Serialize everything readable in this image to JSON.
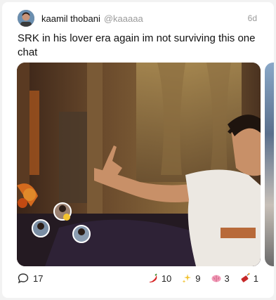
{
  "post": {
    "author_name": "kaamil thobani",
    "author_handle": "@kaaaaa",
    "time": "6d",
    "text": "SRK in his lover era again im not surviving this one chat"
  },
  "reactions": {
    "replies": "17",
    "pepper": "10",
    "sparkle": "9",
    "brain": "3",
    "firecracker": "1"
  },
  "icons": [
    "chat-bubble-icon",
    "pepper-icon",
    "sparkle-icon",
    "brain-icon",
    "firecracker-icon"
  ]
}
